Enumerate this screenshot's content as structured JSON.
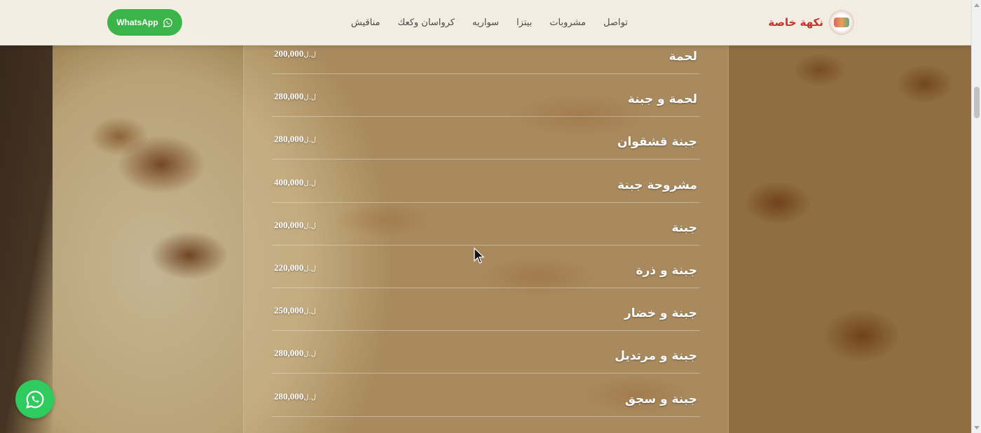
{
  "brand": {
    "name": "نكهة خاصة",
    "logo_icon": "brand-logo-icon"
  },
  "header": {
    "whatsapp_button": {
      "label": "WhatsApp",
      "icon": "whatsapp-icon",
      "color": "#3bb54a"
    },
    "nav": [
      {
        "label": "مناقيش"
      },
      {
        "label": "كرواسان وكعك"
      },
      {
        "label": "سواريه"
      },
      {
        "label": "بيتزا"
      },
      {
        "label": "مشروبات"
      },
      {
        "label": "تواصل"
      }
    ]
  },
  "menu": {
    "currency": "ل.ل",
    "items": [
      {
        "name": "لحمة",
        "price": "200,000"
      },
      {
        "name": "لحمة و جبنة",
        "price": "280,000"
      },
      {
        "name": "جبنة قشقوان",
        "price": "280,000"
      },
      {
        "name": "مشروحة جبنة",
        "price": "400,000"
      },
      {
        "name": "جبنة",
        "price": "200,000"
      },
      {
        "name": "جبنة و ذرة",
        "price": "220,000"
      },
      {
        "name": "جبنة و خضار",
        "price": "250,000"
      },
      {
        "name": "جبنة و مرتديل",
        "price": "280,000"
      },
      {
        "name": "جبنة و سجق",
        "price": "280,000"
      }
    ]
  },
  "floating_whatsapp": {
    "icon": "whatsapp-icon",
    "color": "#2ecc5f"
  },
  "colors": {
    "brand_red": "#c8322b",
    "whatsapp_green": "#3bb54a"
  }
}
